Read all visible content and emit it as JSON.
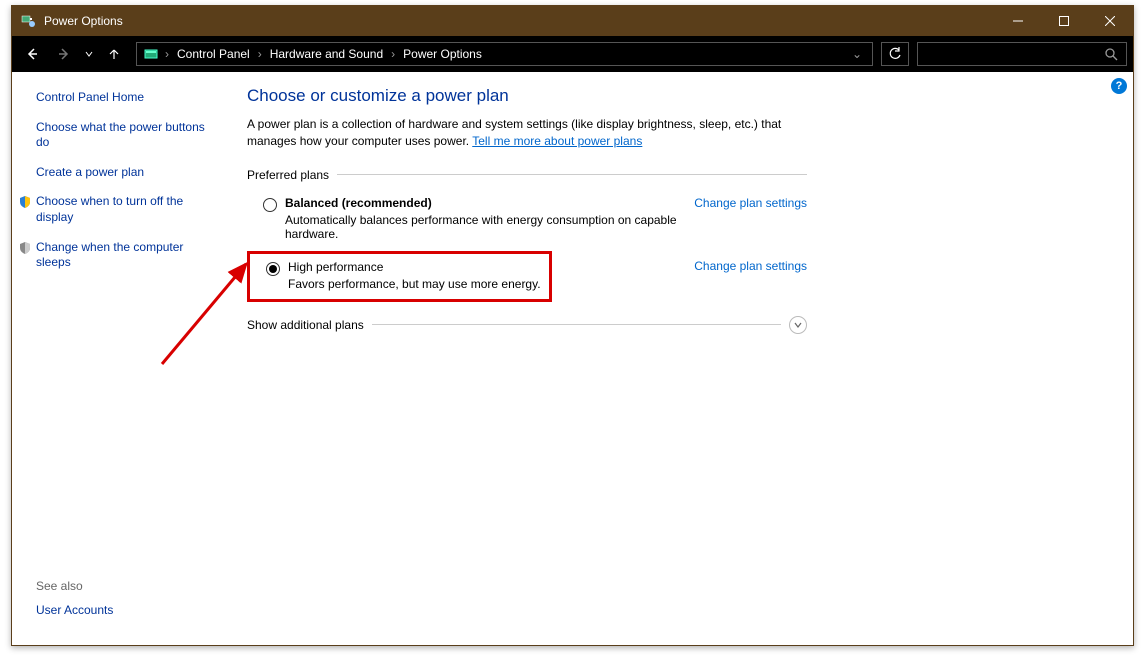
{
  "titlebar": {
    "title": "Power Options"
  },
  "breadcrumb": {
    "items": [
      "Control Panel",
      "Hardware and Sound",
      "Power Options"
    ]
  },
  "sidebar": {
    "home": "Control Panel Home",
    "links": [
      "Choose what the power buttons do",
      "Create a power plan",
      "Choose when to turn off the display",
      "Change when the computer sleeps"
    ],
    "see_also_label": "See also",
    "see_also_links": [
      "User Accounts"
    ]
  },
  "main": {
    "heading": "Choose or customize a power plan",
    "description_pre": "A power plan is a collection of hardware and system settings (like display brightness, sleep, etc.) that manages how your computer uses power. ",
    "description_link": "Tell me more about power plans",
    "preferred_label": "Preferred plans",
    "plans": [
      {
        "name": "Balanced (recommended)",
        "desc": "Automatically balances performance with energy consumption on capable hardware.",
        "selected": false,
        "bold": true,
        "link": "Change plan settings"
      },
      {
        "name": "High performance",
        "desc": "Favors performance, but may use more energy.",
        "selected": true,
        "bold": false,
        "link": "Change plan settings"
      }
    ],
    "show_additional": "Show additional plans"
  }
}
